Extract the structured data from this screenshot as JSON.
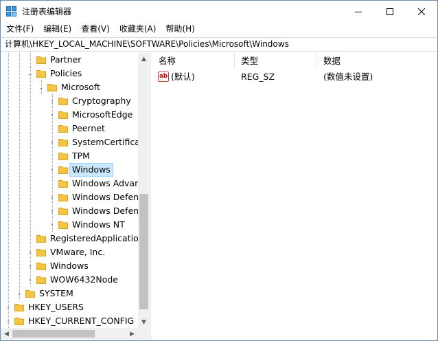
{
  "window": {
    "title": "注册表编辑器",
    "app_icon": "regedit-icon",
    "controls": {
      "minimize": "minimize-icon",
      "maximize": "maximize-icon",
      "close": "close-icon"
    }
  },
  "menu": [
    "文件(F)",
    "编辑(E)",
    "查看(V)",
    "收藏夹(A)",
    "帮助(H)"
  ],
  "address": "计算机\\HKEY_LOCAL_MACHINE\\SOFTWARE\\Policies\\Microsoft\\Windows",
  "tree": [
    {
      "label": "Partner",
      "expander": "none"
    },
    {
      "label": "Policies",
      "expander": "expanded"
    },
    {
      "label": "Microsoft",
      "expander": "expanded"
    },
    {
      "label": "Cryptography",
      "expander": "collapsed"
    },
    {
      "label": "MicrosoftEdge",
      "expander": "collapsed"
    },
    {
      "label": "Peernet",
      "expander": "none"
    },
    {
      "label": "SystemCertificate",
      "expander": "collapsed"
    },
    {
      "label": "TPM",
      "expander": "none"
    },
    {
      "label": "Windows",
      "expander": "collapsed",
      "selected": true
    },
    {
      "label": "Windows Advanc",
      "expander": "none"
    },
    {
      "label": "Windows Defenc",
      "expander": "collapsed"
    },
    {
      "label": "Windows Defenc",
      "expander": "collapsed"
    },
    {
      "label": "Windows NT",
      "expander": "collapsed"
    },
    {
      "label": "RegisteredApplication",
      "expander": "none"
    },
    {
      "label": "VMware, Inc.",
      "expander": "collapsed"
    },
    {
      "label": "Windows",
      "expander": "collapsed"
    },
    {
      "label": "WOW6432Node",
      "expander": "collapsed"
    },
    {
      "label": "SYSTEM",
      "expander": "collapsed"
    },
    {
      "label": "HKEY_USERS",
      "expander": "collapsed"
    },
    {
      "label": "HKEY_CURRENT_CONFIG",
      "expander": "collapsed"
    }
  ],
  "list": {
    "columns": [
      "名称",
      "类型",
      "数据"
    ],
    "rows": [
      {
        "name": "(默认)",
        "type": "REG_SZ",
        "data": "(数值未设置)",
        "icon": "string-value-icon",
        "icon_text": "ab"
      }
    ]
  },
  "colors": {
    "folder": "#f5c542",
    "selection": "#cce8ff",
    "accent": "#0078d7"
  }
}
